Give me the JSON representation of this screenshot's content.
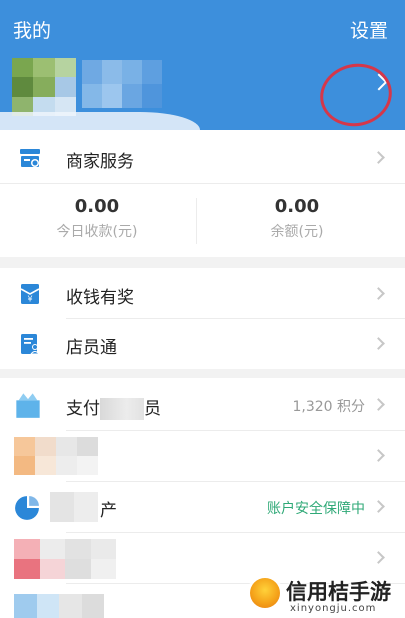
{
  "header": {
    "title": "我的",
    "settings_label": "设置"
  },
  "merchant": {
    "label": "商家服务"
  },
  "stats": [
    {
      "value": "0.00",
      "caption": "今日收款(元)"
    },
    {
      "value": "0.00",
      "caption": "余额(元)"
    }
  ],
  "menu1": [
    {
      "label": "收钱有奖",
      "icon": "reward-envelope-icon"
    },
    {
      "label": "店员通",
      "icon": "staff-document-icon"
    }
  ],
  "menu2": {
    "member": {
      "label_visible": "支付",
      "label_tail": "员",
      "value": "1,320 积分"
    },
    "assets": {
      "label_tail": "产",
      "value": "账户安全保障中"
    }
  },
  "watermark": {
    "title": "信用桔手游",
    "subtitle": "xinyongju.com"
  },
  "colors": {
    "header_blue": "#3d8fdc",
    "icon_blue": "#2b87d8",
    "secure_green": "#2fa977",
    "annotation_red": "#d5374a"
  }
}
